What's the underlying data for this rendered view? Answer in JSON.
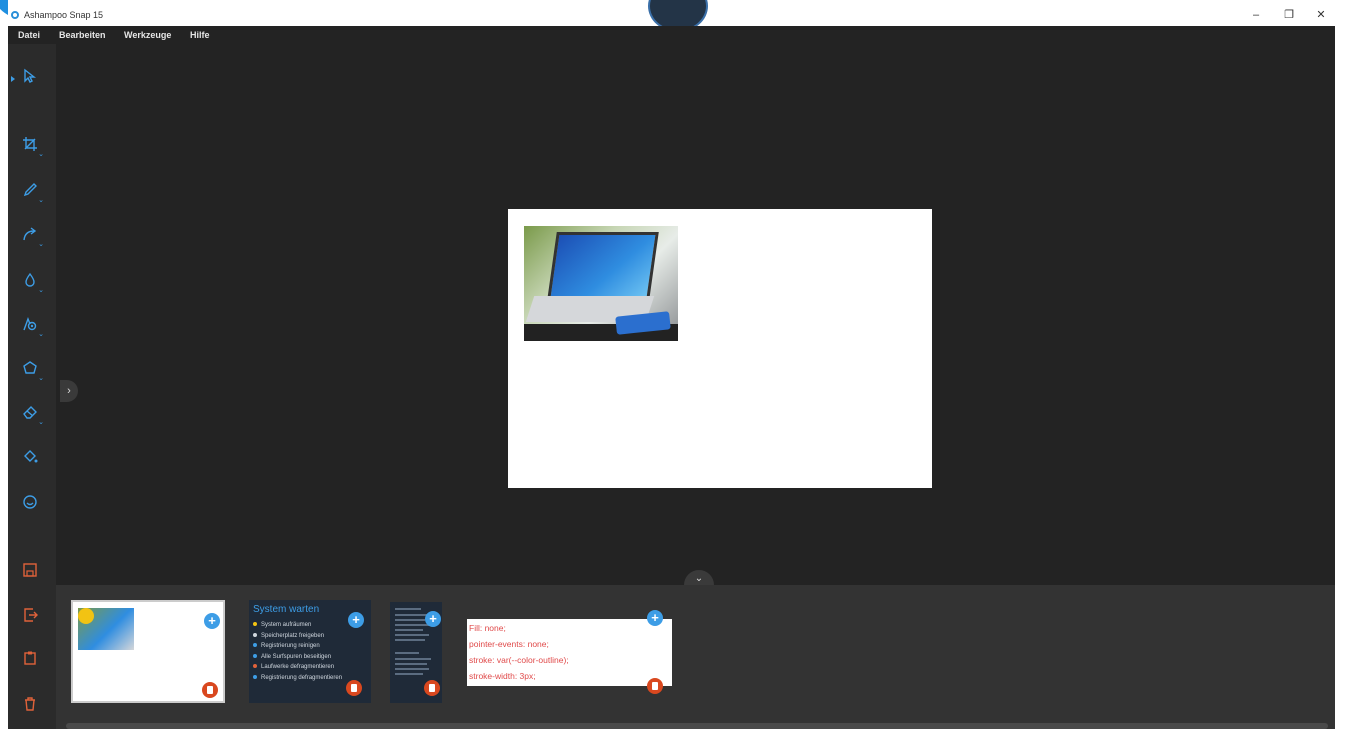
{
  "window": {
    "title": "Ashampoo Snap 15"
  },
  "menubar": {
    "items": [
      "Datei",
      "Bearbeiten",
      "Werkzeuge",
      "Hilfe"
    ]
  },
  "window_controls": {
    "minimize": "–",
    "maximize": "❐",
    "close": "✕"
  },
  "sidebar": {
    "tools": [
      "select-icon",
      "crop-icon",
      "pen-icon",
      "arrow-icon",
      "blur-icon",
      "text-icon",
      "shape-icon",
      "eraser-icon",
      "fill-icon",
      "emoji-icon"
    ],
    "actions": [
      "save-icon",
      "export-icon",
      "clipboard-icon",
      "delete-icon"
    ]
  },
  "colors": {
    "accent": "#3d9de6",
    "danger": "#d9481f",
    "background": "#232323",
    "tray": "#333333"
  },
  "tray": {
    "thumbnails": [
      {
        "type": "image"
      },
      {
        "type": "text-card",
        "title": "System warten",
        "items": [
          "System aufräumen",
          "Speicherplatz freigeben",
          "Registrierung reinigen",
          "Alle Surfspuren beseitigen",
          "Laufwerke defragmentieren",
          "Registrierung defragmentieren"
        ]
      },
      {
        "type": "text-card-small"
      },
      {
        "type": "code-snippet",
        "lines": [
          "Fill: none;",
          "pointer-events: none;",
          "stroke: var(--color-outline);",
          "stroke-width: 3px;"
        ]
      }
    ]
  }
}
